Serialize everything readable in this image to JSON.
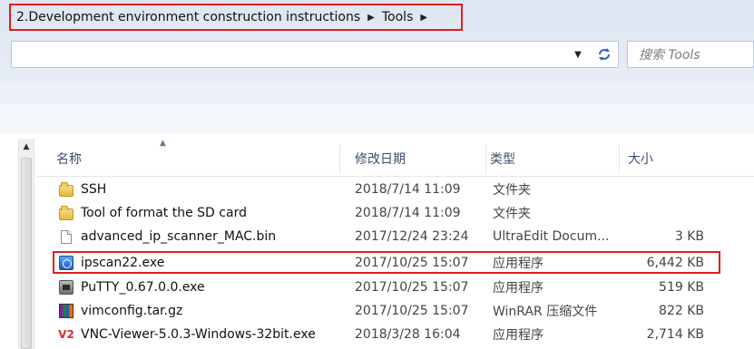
{
  "breadcrumb": {
    "items": [
      "2.Development environment construction instructions",
      "Tools"
    ]
  },
  "toolbar": {
    "dropdown_icon": "chevron-down-icon",
    "refresh_icon": "refresh-icon"
  },
  "search": {
    "placeholder": "搜索 Tools"
  },
  "columns": [
    "名称",
    "修改日期",
    "类型",
    "大小"
  ],
  "rows": [
    {
      "name": "SSH",
      "date": "2018/7/14 11:09",
      "type": "文件夹",
      "size": "",
      "icon": "folder-icon"
    },
    {
      "name": "Tool of format the SD card",
      "date": "2018/7/14 11:09",
      "type": "文件夹",
      "size": "",
      "icon": "folder-icon"
    },
    {
      "name": "advanced_ip_scanner_MAC.bin",
      "date": "2017/12/24 23:24",
      "type": "UltraEdit Docum...",
      "size": "3 KB",
      "icon": "file-icon"
    },
    {
      "name": "ipscan22.exe",
      "date": "2017/10/25 15:07",
      "type": "应用程序",
      "size": "6,442 KB",
      "icon": "app-icon"
    },
    {
      "name": "PuTTY_0.67.0.0.exe",
      "date": "2017/10/25 15:07",
      "type": "应用程序",
      "size": "519 KB",
      "icon": "putty-icon"
    },
    {
      "name": "vimconfig.tar.gz",
      "date": "2017/10/25 15:07",
      "type": "WinRAR 压缩文件",
      "size": "822 KB",
      "icon": "archive-icon"
    },
    {
      "name": "VNC-Viewer-5.0.3-Windows-32bit.exe",
      "date": "2018/3/28 16:04",
      "type": "应用程序",
      "size": "2,714 KB",
      "icon": "vnc-icon"
    }
  ],
  "colors": {
    "highlight": "#e21d1d",
    "header_text": "#3d4e72"
  }
}
